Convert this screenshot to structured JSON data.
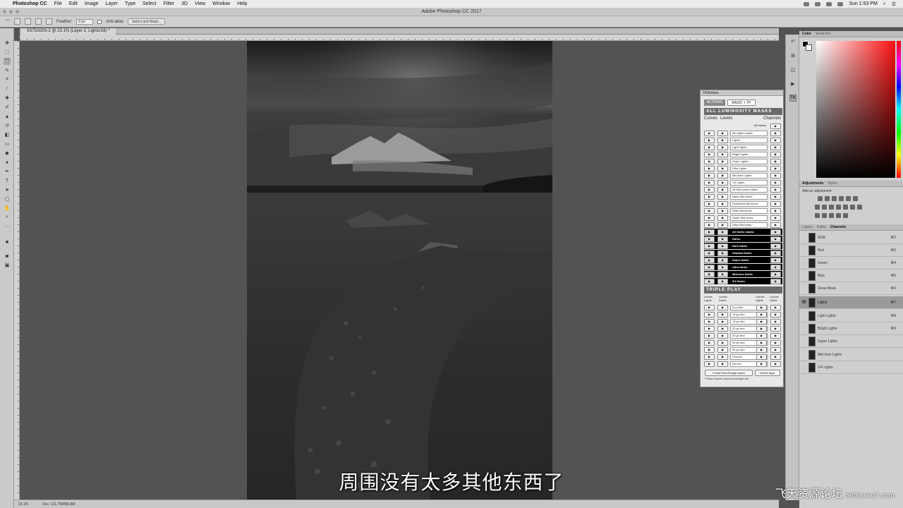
{
  "menubar": {
    "app": "Photoshop CC",
    "items": [
      "File",
      "Edit",
      "Image",
      "Layer",
      "Type",
      "Select",
      "Filter",
      "3D",
      "View",
      "Window",
      "Help"
    ],
    "clock": "Sun 1:53 PM"
  },
  "window": {
    "title": "Adobe Photoshop CC 2017"
  },
  "options": {
    "feather_label": "Feather:",
    "feather_value": "0 px",
    "antialias_label": "Anti-alias",
    "select_mask_label": "Select and Mask..."
  },
  "document": {
    "tab": "5S7D3303-2 @ 23.1% (Layer 2, Lights/16) *"
  },
  "status": {
    "zoom": "23.1%",
    "doc": "Doc: 121.7M/883.8M"
  },
  "subtitle": "周围没有太多其他东西了",
  "watermark": {
    "main": "飞天资源论坛",
    "site": "feitianwu7.com"
  },
  "color_panel": {
    "tabs": [
      "Color",
      "Swatches"
    ]
  },
  "adjustments": {
    "tabs": [
      "Adjustments",
      "Styles"
    ],
    "title": "Add an adjustment"
  },
  "layers_panel": {
    "tabs": [
      "Layers",
      "Paths",
      "Channels"
    ],
    "channels": [
      {
        "name": "RGB",
        "key": "⌘2"
      },
      {
        "name": "Red",
        "key": "⌘3"
      },
      {
        "name": "Green",
        "key": "⌘4"
      },
      {
        "name": "Blue",
        "key": "⌘5"
      },
      {
        "name": "Snow Mask",
        "key": "⌘6"
      },
      {
        "name": "Lights",
        "key": "⌘7"
      },
      {
        "name": "Light Lights",
        "key": "⌘8"
      },
      {
        "name": "Bright Lights",
        "key": "⌘9"
      },
      {
        "name": "Super Lights",
        "key": ""
      },
      {
        "name": "Mid-tone Lights",
        "key": ""
      },
      {
        "name": "1/4 Lights",
        "key": ""
      }
    ]
  },
  "tk": {
    "title": "TKActions",
    "tab_actions": "ACTIONS",
    "tab_basic": "BASIC + TP",
    "section_all": "ALL LUMINOSITY MASKS",
    "curves": "Curves",
    "levels": "Levels",
    "channels": "Channels",
    "all_masks": "All Masks",
    "play": "▶",
    "light_rows": [
      "All Lights masks",
      "Lights",
      "Light Lights",
      "Bright Lights",
      "Super Lights",
      "Ultra Lights",
      "Mid-tone Lights",
      "1/4 Lights",
      "All Mid-tones masks",
      "Basic Mid-tones",
      "Expanded Mid-tones",
      "Wide Mid-tones",
      "Super Mid-tones",
      "Ultra Mid-tones"
    ],
    "dark_rows": [
      "All Darks masks",
      "Darks",
      "Dark Darks",
      "Shadow Darks",
      "Super Darks",
      "Ultra Darks",
      "Mid-tone Darks",
      "3/4 Darks"
    ],
    "section_triple": "TRIPLE PLAY",
    "tp_levels_lights": "Levels Lights",
    "tp_levels_darks": "Levels Darks",
    "tp_curves_lights": "Curves Lights",
    "tp_curves_darks": "Curves Darks",
    "tp_rows": [
      "5-px blur",
      "10-px blur",
      "15-px blur",
      "20-px blur",
      "30-px blur",
      "40-px blur",
      "60-px blur",
      "Choose",
      "No blur"
    ],
    "create_btn": "Create Burn/Dodge layers",
    "delete_btn": "Delete layer",
    "credit": "©Tony Kuyper (www.GoodLight.us)"
  }
}
